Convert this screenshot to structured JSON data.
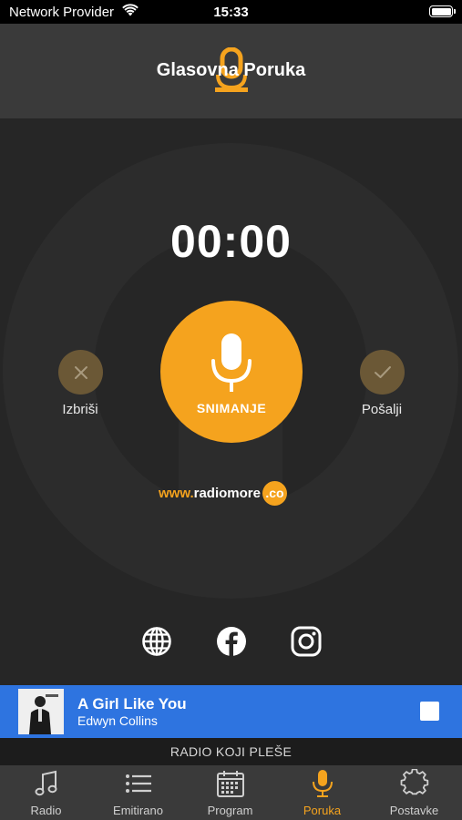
{
  "status_bar": {
    "carrier": "Network Provider",
    "time": "15:33"
  },
  "header": {
    "title": "Glasovna Poruka",
    "icon": "microphone-icon"
  },
  "recorder": {
    "timer": "00:00",
    "record_label": "SNIMANJE",
    "delete_label": "Izbriši",
    "send_label": "Pošalji"
  },
  "brand": {
    "www": "www.",
    "name": "radiomore",
    "tld": ".co"
  },
  "social": [
    {
      "icon": "globe-icon"
    },
    {
      "icon": "facebook-icon"
    },
    {
      "icon": "instagram-icon"
    }
  ],
  "now_playing": {
    "title": "A Girl Like You",
    "artist": "Edwyn Collins",
    "slogan": "RADIO KOJI PLEŠE"
  },
  "tabs": [
    {
      "label": "Radio",
      "icon": "music-note-icon",
      "active": false
    },
    {
      "label": "Emitirano",
      "icon": "list-icon",
      "active": false
    },
    {
      "label": "Program",
      "icon": "calendar-icon",
      "active": false
    },
    {
      "label": "Poruka",
      "icon": "microphone-icon",
      "active": true
    },
    {
      "label": "Postavke",
      "icon": "gear-icon",
      "active": false
    }
  ],
  "colors": {
    "accent": "#f5a31e",
    "now_playing_bg": "#2e74e0",
    "background": "#262626",
    "header_bg": "#3a3a3a"
  }
}
